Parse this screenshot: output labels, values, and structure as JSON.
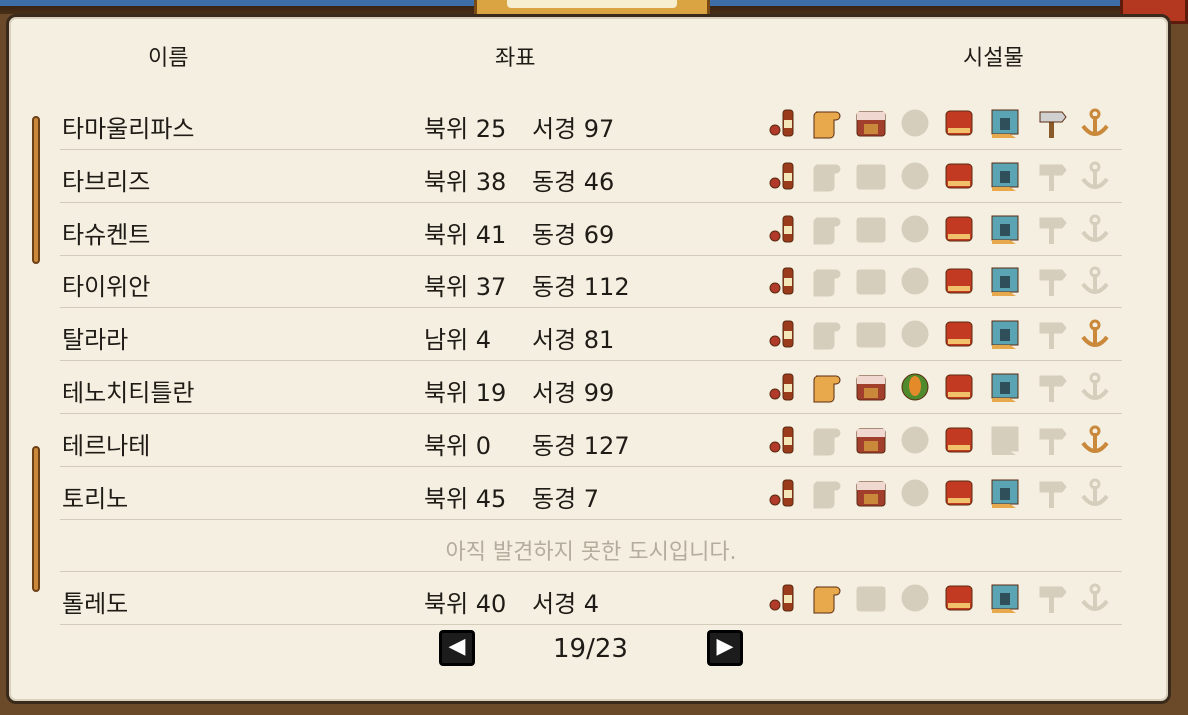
{
  "headers": {
    "name": "이름",
    "coord": "좌표",
    "facilities": "시설물"
  },
  "rows": [
    {
      "name": "타마울리파스",
      "lat": "북위 25",
      "lon": "서경 97",
      "fac": [
        1,
        1,
        1,
        0,
        1,
        1,
        1,
        1
      ]
    },
    {
      "name": "타브리즈",
      "lat": "북위 38",
      "lon": "동경 46",
      "fac": [
        1,
        0,
        0,
        0,
        1,
        1,
        0,
        0
      ]
    },
    {
      "name": "타슈켄트",
      "lat": "북위 41",
      "lon": "동경 69",
      "fac": [
        1,
        0,
        0,
        0,
        1,
        1,
        0,
        0
      ]
    },
    {
      "name": "타이위안",
      "lat": "북위 37",
      "lon": "동경 112",
      "fac": [
        1,
        0,
        0,
        0,
        1,
        1,
        0,
        0
      ]
    },
    {
      "name": "탈라라",
      "lat": "남위 4",
      "lon": "서경 81",
      "fac": [
        1,
        0,
        0,
        0,
        1,
        1,
        0,
        1
      ]
    },
    {
      "name": "테노치티틀란",
      "lat": "북위 19",
      "lon": "서경 99",
      "fac": [
        1,
        1,
        1,
        1,
        1,
        1,
        0,
        0
      ]
    },
    {
      "name": "테르나테",
      "lat": "북위 0",
      "lon": "동경 127",
      "fac": [
        1,
        0,
        1,
        0,
        1,
        0,
        0,
        1
      ]
    },
    {
      "name": "토리노",
      "lat": "북위 45",
      "lon": "동경 7",
      "fac": [
        1,
        0,
        1,
        0,
        1,
        1,
        0,
        0
      ]
    },
    {
      "undiscovered": "아직 발견하지 못한 도시입니다."
    },
    {
      "name": "톨레도",
      "lat": "북위 40",
      "lon": "서경 4",
      "fac": [
        1,
        1,
        0,
        0,
        1,
        1,
        0,
        0
      ]
    }
  ],
  "facility_icons": [
    "tavern-icon",
    "scroll-icon",
    "market-icon",
    "shrine-icon",
    "bed-inn-icon",
    "castle-icon",
    "signpost-icon",
    "anchor-icon"
  ],
  "pager": {
    "text": "19/23",
    "prev": "◀",
    "next": "▶"
  },
  "colors": {
    "active_fill": "#c9582c",
    "inactive_fill": "#d6cebd"
  }
}
